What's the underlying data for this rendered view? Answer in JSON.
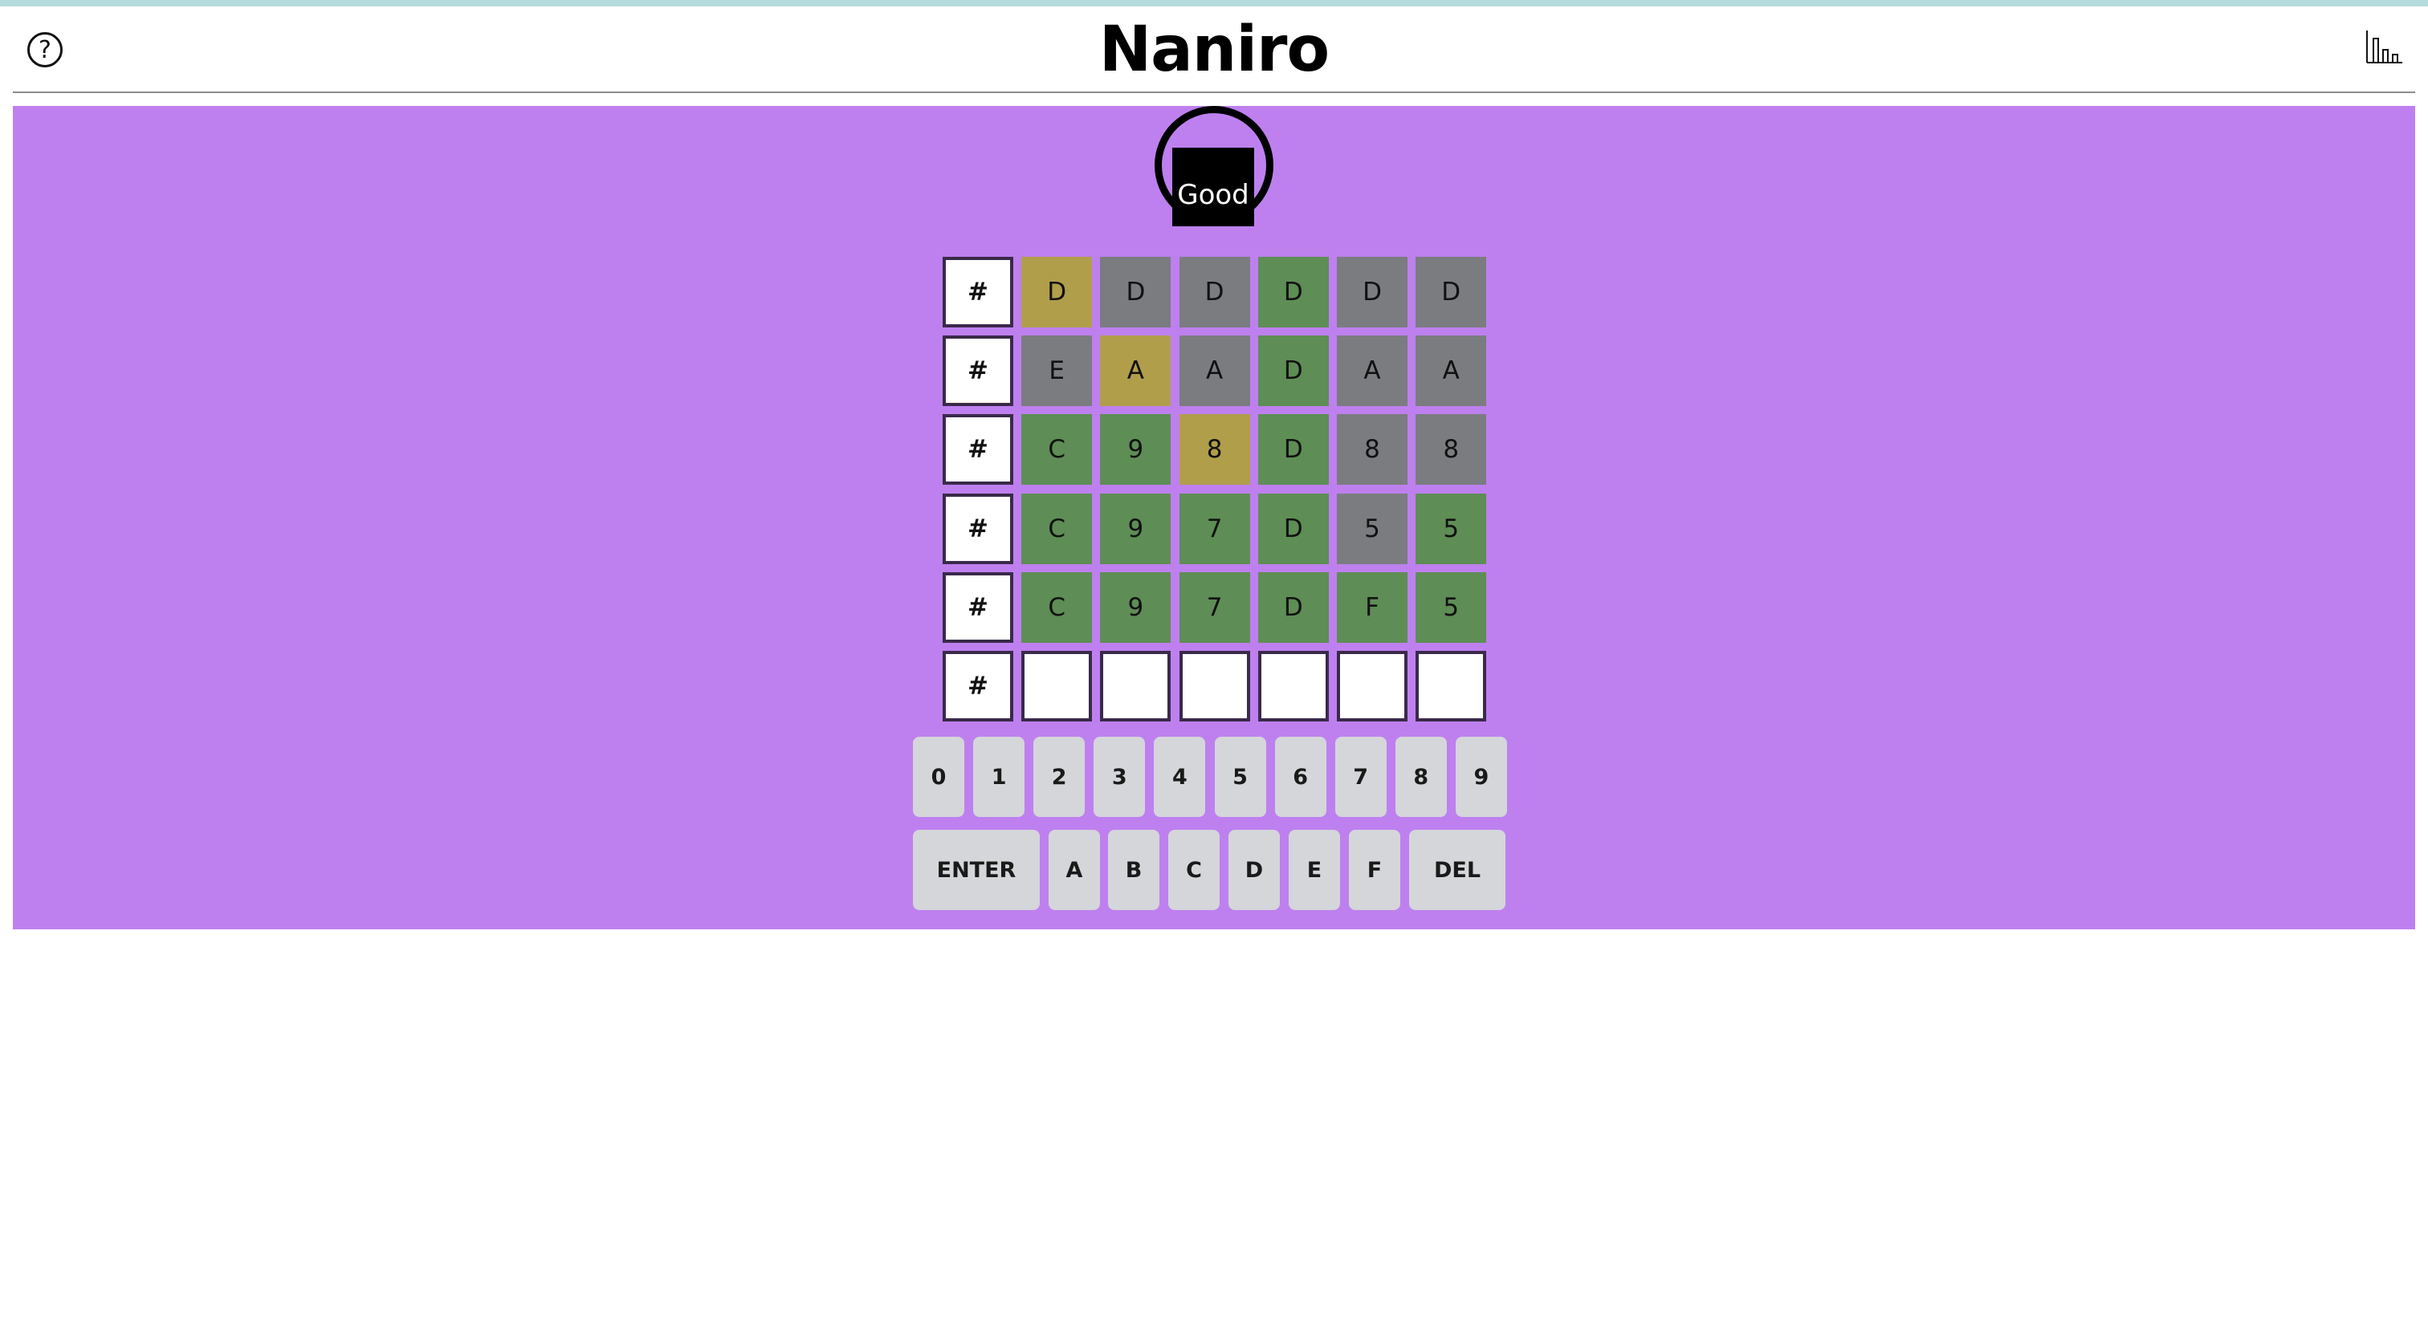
{
  "app": {
    "title": "Naniro",
    "help_icon": "?",
    "stats_icon": "bar-chart-icon"
  },
  "feedback": {
    "label": "Good"
  },
  "board": {
    "row_marker": "#",
    "rows": [
      {
        "cells": [
          {
            "char": "D",
            "state": "present"
          },
          {
            "char": "D",
            "state": "absent"
          },
          {
            "char": "D",
            "state": "absent"
          },
          {
            "char": "D",
            "state": "correct"
          },
          {
            "char": "D",
            "state": "absent"
          },
          {
            "char": "D",
            "state": "absent"
          }
        ]
      },
      {
        "cells": [
          {
            "char": "E",
            "state": "absent"
          },
          {
            "char": "A",
            "state": "present"
          },
          {
            "char": "A",
            "state": "absent"
          },
          {
            "char": "D",
            "state": "correct"
          },
          {
            "char": "A",
            "state": "absent"
          },
          {
            "char": "A",
            "state": "absent"
          }
        ]
      },
      {
        "cells": [
          {
            "char": "C",
            "state": "correct"
          },
          {
            "char": "9",
            "state": "correct"
          },
          {
            "char": "8",
            "state": "present"
          },
          {
            "char": "D",
            "state": "correct"
          },
          {
            "char": "8",
            "state": "absent"
          },
          {
            "char": "8",
            "state": "absent"
          }
        ]
      },
      {
        "cells": [
          {
            "char": "C",
            "state": "correct"
          },
          {
            "char": "9",
            "state": "correct"
          },
          {
            "char": "7",
            "state": "correct"
          },
          {
            "char": "D",
            "state": "correct"
          },
          {
            "char": "5",
            "state": "absent"
          },
          {
            "char": "5",
            "state": "correct"
          }
        ]
      },
      {
        "cells": [
          {
            "char": "C",
            "state": "correct"
          },
          {
            "char": "9",
            "state": "correct"
          },
          {
            "char": "7",
            "state": "correct"
          },
          {
            "char": "D",
            "state": "correct"
          },
          {
            "char": "F",
            "state": "correct"
          },
          {
            "char": "5",
            "state": "correct"
          }
        ]
      },
      {
        "cells": [
          {
            "char": "",
            "state": "empty"
          },
          {
            "char": "",
            "state": "empty"
          },
          {
            "char": "",
            "state": "empty"
          },
          {
            "char": "",
            "state": "empty"
          },
          {
            "char": "",
            "state": "empty"
          },
          {
            "char": "",
            "state": "empty"
          }
        ]
      }
    ]
  },
  "keyboard": {
    "digit_row": [
      "0",
      "1",
      "2",
      "3",
      "4",
      "5",
      "6",
      "7",
      "8",
      "9"
    ],
    "enter_label": "ENTER",
    "letter_row": [
      "A",
      "B",
      "C",
      "D",
      "E",
      "F"
    ],
    "delete_label": "DEL"
  },
  "colors": {
    "background": "#be80ef",
    "correct": "#5e8d55",
    "present": "#b09e4b",
    "absent": "#7a7c80",
    "key": "#d4d6da"
  }
}
